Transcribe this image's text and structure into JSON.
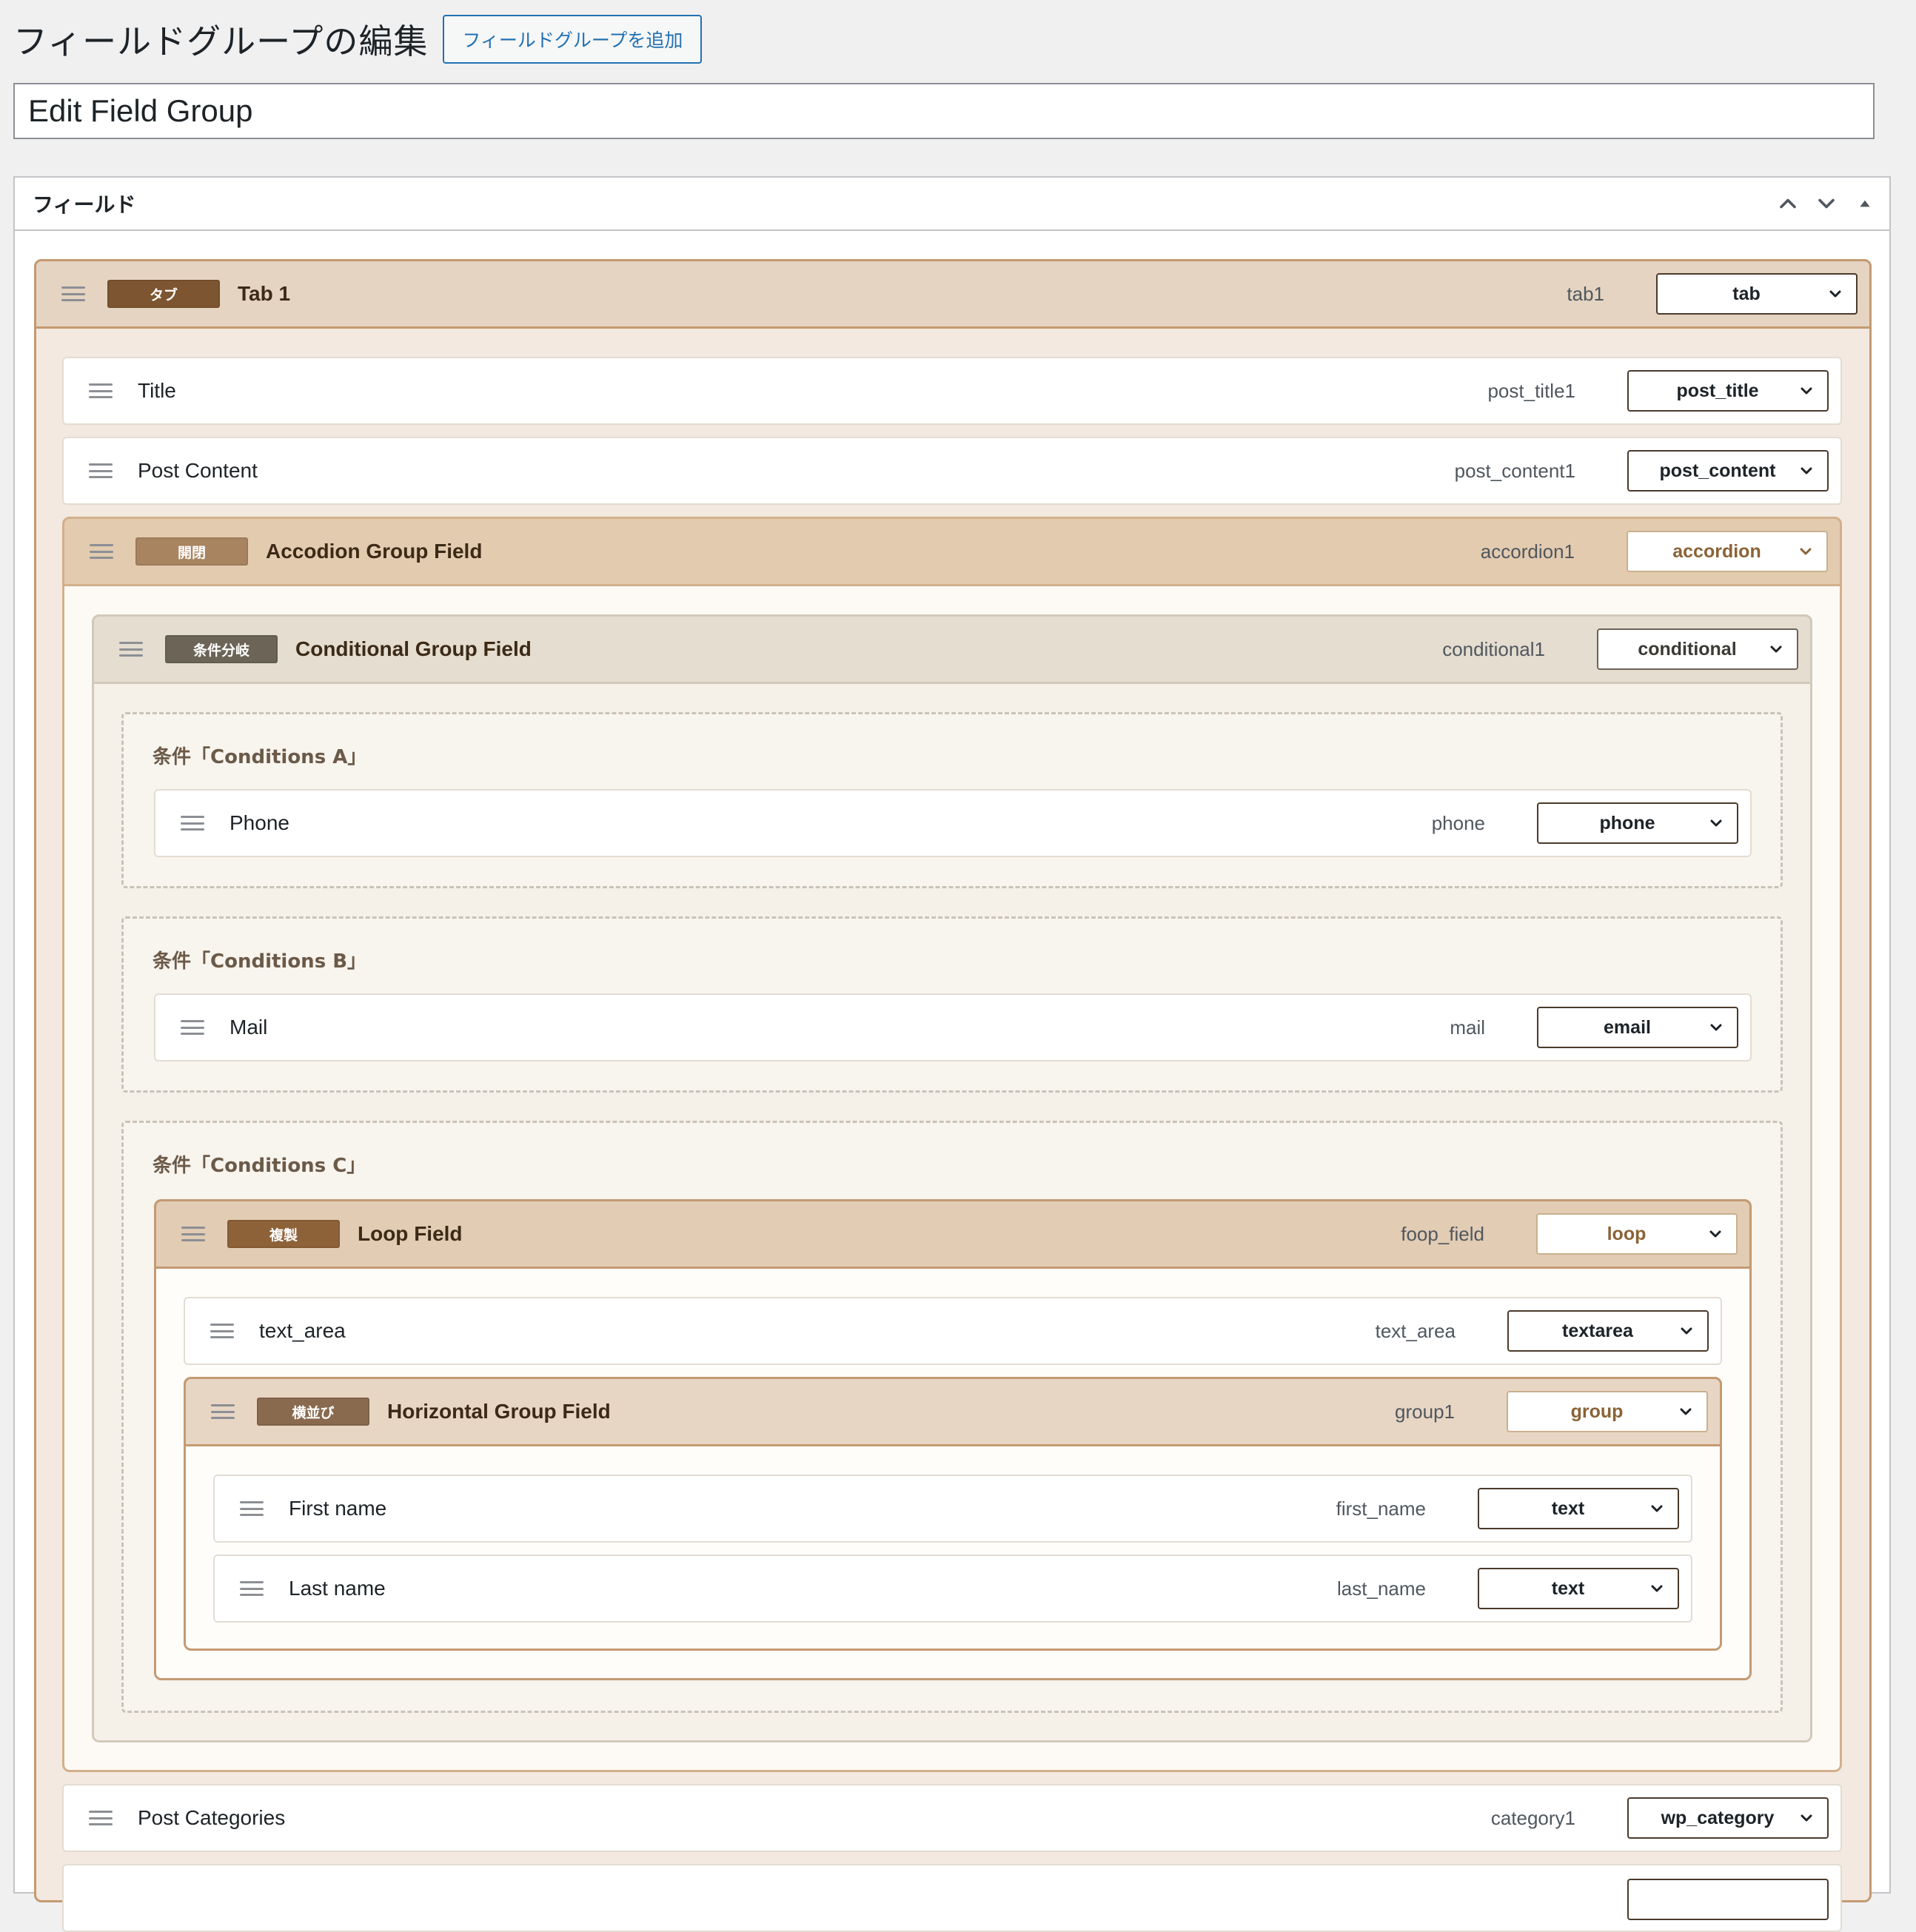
{
  "header": {
    "title": "フィールドグループの編集",
    "add_button": "フィールドグループを追加"
  },
  "title_input": {
    "value": "Edit Field Group"
  },
  "postbox": {
    "title": "フィールド"
  },
  "rows": {
    "tab": {
      "badge": "タブ",
      "label": "Tab 1",
      "slug": "tab1",
      "type": "tab"
    },
    "title": {
      "label": "Title",
      "slug": "post_title1",
      "type": "post_title"
    },
    "content": {
      "label": "Post Content",
      "slug": "post_content1",
      "type": "post_content"
    },
    "accordion": {
      "badge": "開閉",
      "label": "Accodion Group Field",
      "slug": "accordion1",
      "type": "accordion"
    },
    "conditional": {
      "badge": "条件分岐",
      "label": "Conditional Group Field",
      "slug": "conditional1",
      "type": "conditional"
    },
    "cond_a": {
      "label": "条件「Conditions A」"
    },
    "phone": {
      "label": "Phone",
      "slug": "phone",
      "type": "phone"
    },
    "cond_b": {
      "label": "条件「Conditions B」"
    },
    "mail": {
      "label": "Mail",
      "slug": "mail",
      "type": "email"
    },
    "cond_c": {
      "label": "条件「Conditions C」"
    },
    "loop": {
      "badge": "複製",
      "label": "Loop Field",
      "slug": "foop_field",
      "type": "loop"
    },
    "textarea": {
      "label": "text_area",
      "slug": "text_area",
      "type": "textarea"
    },
    "horizontal": {
      "badge": "横並び",
      "label": "Horizontal Group Field",
      "slug": "group1",
      "type": "group"
    },
    "first_name": {
      "label": "First name",
      "slug": "first_name",
      "type": "text"
    },
    "last_name": {
      "label": "Last name",
      "slug": "last_name",
      "type": "text"
    },
    "categories": {
      "label": "Post Categories",
      "slug": "category1",
      "type": "wp_category"
    }
  },
  "colors": {
    "tab_badge": "#7d5530",
    "accordion_badge": "#a98460",
    "conditional_badge": "#6b6457",
    "loop_badge": "#8e6239",
    "horizontal_badge": "#8a6a4f",
    "accent_link": "#2271b1"
  },
  "icons": [
    "chevron-up-icon",
    "chevron-down-icon",
    "triangle-up-icon",
    "drag-handle-icon"
  ]
}
